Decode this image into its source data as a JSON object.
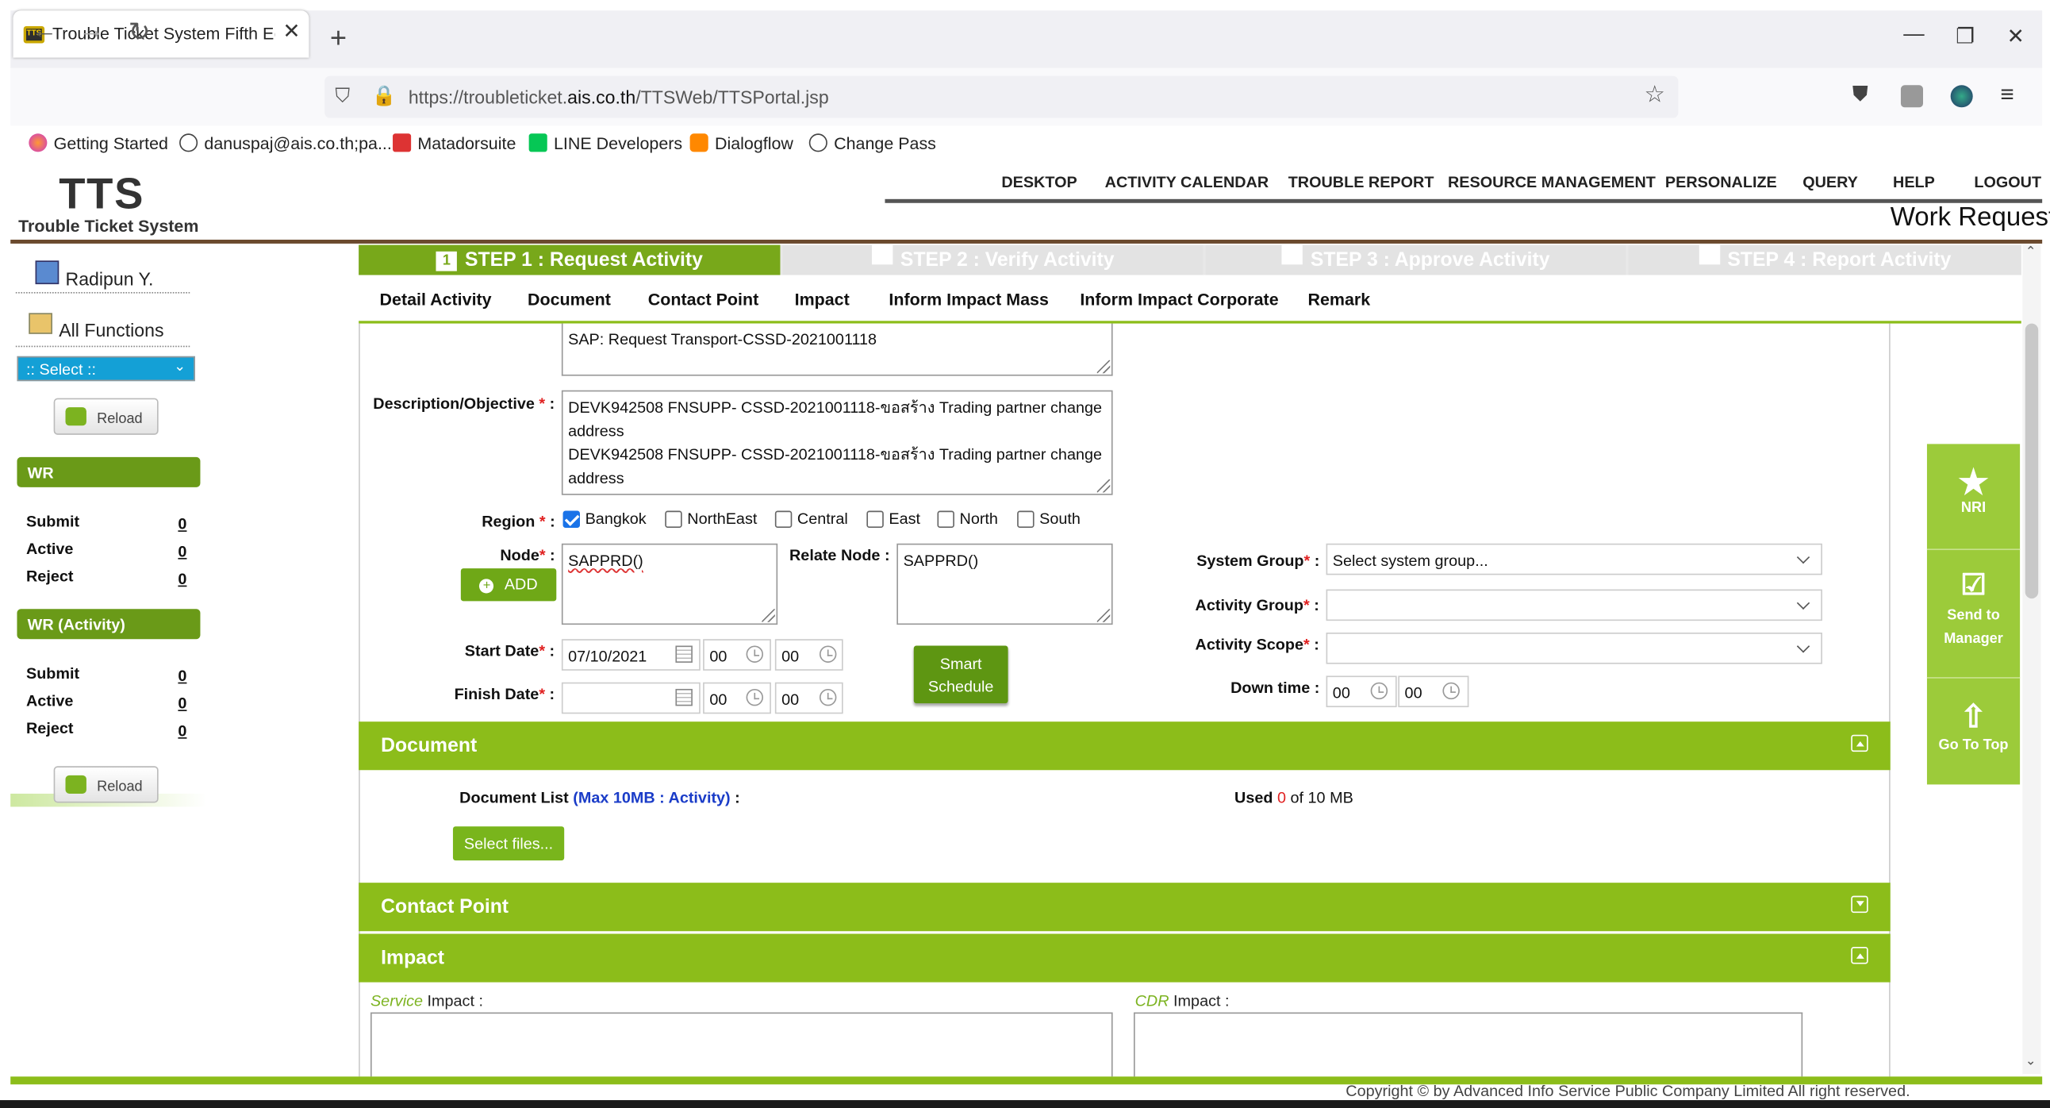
{
  "browser": {
    "tab_title": "Trouble Ticket System Fifth Editi",
    "tab_favicon": "TTS",
    "url_prefix": "https://troubleticket.",
    "url_domain": "ais.co.th",
    "url_path": "/TTSWeb/TTSPortal.jsp",
    "bookmarks": [
      "Getting Started",
      "danuspaj@ais.co.th;pa...",
      "Matadorsuite",
      "LINE Developers",
      "Dialogflow",
      "Change Pass"
    ]
  },
  "header": {
    "logo": "TTS",
    "logo_sub": "Trouble Ticket System",
    "menu": [
      "DESKTOP",
      "ACTIVITY CALENDAR",
      "TROUBLE REPORT",
      "RESOURCE MANAGEMENT",
      "PERSONALIZE",
      "QUERY",
      "HELP",
      "LOGOUT"
    ],
    "page_title": "Work Request"
  },
  "sidebar": {
    "user": "Radipun Y.",
    "all_functions": "All Functions",
    "select_value": ":: Select ::",
    "reload": "Reload",
    "wr_title": "WR",
    "wr_rows": [
      {
        "label": "Submit",
        "count": "0"
      },
      {
        "label": "Active",
        "count": "0"
      },
      {
        "label": "Reject",
        "count": "0"
      }
    ],
    "wra_title": "WR (Activity)",
    "wra_rows": [
      {
        "label": "Submit",
        "count": "0"
      },
      {
        "label": "Active",
        "count": "0"
      },
      {
        "label": "Reject",
        "count": "0"
      }
    ]
  },
  "steps": [
    {
      "num": "1",
      "label": "STEP 1 : Request Activity"
    },
    {
      "num": "",
      "label": "STEP 2 : Verify Activity"
    },
    {
      "num": "",
      "label": "STEP 3 : Approve Activity"
    },
    {
      "num": "",
      "label": "STEP 4 : Report Activity"
    }
  ],
  "subtabs": [
    "Detail Activity",
    "Document",
    "Contact Point",
    "Impact",
    "Inform Impact Mass",
    "Inform Impact Corporate",
    "Remark"
  ],
  "form": {
    "title_value": "SAP: Request Transport-CSSD-2021001118",
    "desc_label": "Description/Objective",
    "desc_value": "DEVK942508 FNSUPP- CSSD-2021001118-ขอสร้าง Trading partner change address\nDEVK942508 FNSUPP- CSSD-2021001118-ขอสร้าง Trading partner change address",
    "region_label": "Region",
    "regions": [
      {
        "label": "Bangkok",
        "checked": true
      },
      {
        "label": "NorthEast",
        "checked": false
      },
      {
        "label": "Central",
        "checked": false
      },
      {
        "label": "East",
        "checked": false
      },
      {
        "label": "North",
        "checked": false
      },
      {
        "label": "South",
        "checked": false
      }
    ],
    "node_label": "Node",
    "node_value": "SAPPRD()",
    "add_label": "ADD",
    "relate_node_label": "Relate Node :",
    "relate_node_value": "SAPPRD()",
    "start_label": "Start Date",
    "start_date": "07/10/2021",
    "start_hh": "00",
    "start_mm": "00",
    "finish_label": "Finish Date",
    "finish_date": "",
    "finish_hh": "00",
    "finish_mm": "00",
    "smart_schedule": "Smart Schedule",
    "system_group_label": "System Group",
    "system_group_value": "Select system group...",
    "activity_group_label": "Activity Group",
    "activity_group_value": "",
    "activity_scope_label": "Activity Scope",
    "activity_scope_value": "",
    "down_time_label": "Down time :",
    "down_hh": "00",
    "down_mm": "00"
  },
  "document": {
    "title": "Document",
    "list_label": "Document List",
    "list_hint": "(Max 10MB : Activity)",
    "used_prefix": "Used",
    "used_value": "0",
    "used_suffix": "of 10 MB",
    "select_files": "Select files..."
  },
  "contact_point": {
    "title": "Contact Point"
  },
  "impact": {
    "title": "Impact",
    "service_label": "Service",
    "service_suffix": "Impact :",
    "cdr_label": "CDR",
    "cdr_suffix": "Impact :"
  },
  "right_panel": [
    "NRI",
    "Send to Manager",
    "Go To Top"
  ],
  "footer": {
    "copyright": "Copyright © by Advanced Info Service Public Company Limited All right reserved."
  },
  "colors": {
    "accent_green": "#8cbd1a",
    "dark_green": "#6a9a18",
    "select_blue": "#14a0d6",
    "required_red": "#e02020",
    "hint_blue": "#1a3cc8"
  }
}
